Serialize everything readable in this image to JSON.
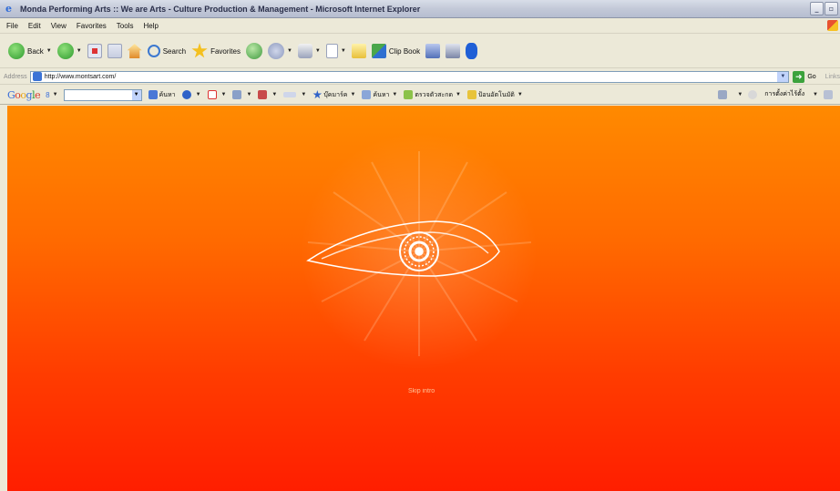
{
  "window": {
    "title": "Monda Performing Arts :: We are Arts - Culture Production & Management - Microsoft Internet Explorer"
  },
  "menu": [
    "File",
    "Edit",
    "View",
    "Favorites",
    "Tools",
    "Help"
  ],
  "toolbar": {
    "back_label": "Back",
    "search_label": "Search",
    "favorites_label": "Favorites",
    "clipbook_label": "Clip Book"
  },
  "address": {
    "label": "Address",
    "url": "http://www.montsart.com/",
    "go_label": "Go",
    "links_label": "Links"
  },
  "google_toolbar": {
    "logo": "Google",
    "tiny_label": "8",
    "search_label": "ค้นหา",
    "bookmark_label": "บุ๊คมาร์ค",
    "search2_label": "ค้นหา",
    "check_label": "ตรวจตัวสะกด",
    "autofill_label": "ป้อนอัตโนมัติ",
    "settings_label": "การตั้งค่าไร้ตั้ง"
  },
  "page": {
    "skip_intro": "Skip intro"
  },
  "colors": {
    "gradient_top": "#ff8a00",
    "gradient_bottom": "#ff1e00"
  }
}
